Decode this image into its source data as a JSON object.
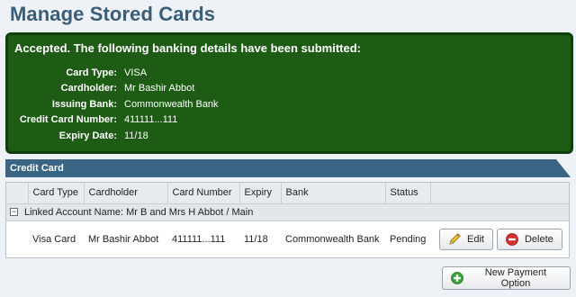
{
  "page": {
    "title": "Manage Stored Cards"
  },
  "confirmation": {
    "heading": "Accepted. The following banking details have been submitted:",
    "fields": [
      {
        "label": "Card Type:",
        "value": "VISA"
      },
      {
        "label": "Cardholder:",
        "value": "Mr Bashir Abbot"
      },
      {
        "label": "Issuing Bank:",
        "value": "Commonwealth Bank"
      },
      {
        "label": "Credit Card Number:",
        "value": "411111...111"
      },
      {
        "label": "Expiry Date:",
        "value": "11/18"
      }
    ]
  },
  "section": {
    "title": "Credit Card"
  },
  "table": {
    "columns": [
      "Card Type",
      "Cardholder",
      "Card Number",
      "Expiry",
      "Bank",
      "Status"
    ],
    "group": {
      "toggle": "−",
      "label": "Linked Account Name: Mr B and Mrs H Abbot / Main"
    },
    "rows": [
      {
        "card_type": "Visa Card",
        "cardholder": "Mr Bashir Abbot",
        "card_number": "411111...111",
        "expiry": "11/18",
        "bank": "Commonwealth Bank",
        "status": "Pending",
        "edit_label": "Edit",
        "delete_label": "Delete"
      }
    ]
  },
  "actions": {
    "new_payment_label": "New Payment Option"
  },
  "colors": {
    "title": "#3a5d78",
    "success_bg": "#1e5c16",
    "header_bg": "#3b6585",
    "delete_icon": "#d0312d",
    "add_icon": "#3aa33a"
  }
}
